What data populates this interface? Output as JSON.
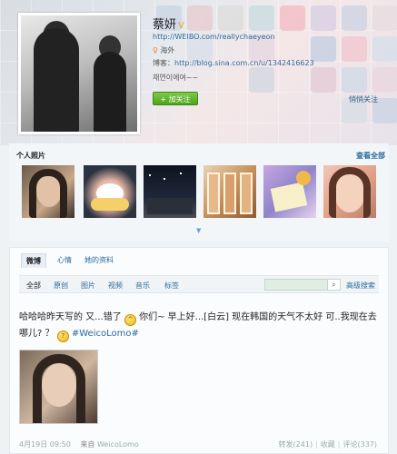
{
  "profile": {
    "name": "蔡妍",
    "verified_badge": "V",
    "url": "http://WEIBO.com/reallychaeyeon",
    "location": "海外",
    "blog_label": "博客：",
    "blog_url": "http://blog.sina.com.cn/u/1342416623",
    "bio": "채연이에여~~",
    "follow_button": "+ 加关注",
    "mutual_follow": "悄悄关注"
  },
  "photos": {
    "title": "个人照片",
    "see_all": "查看全部"
  },
  "tabs": [
    "微博",
    "心情",
    "她的资料"
  ],
  "filters": [
    "全部",
    "原创",
    "图片",
    "视频",
    "音乐",
    "标签"
  ],
  "search": {
    "placeholder": "",
    "advanced": "高级搜索"
  },
  "post": {
    "text_1": "哈哈哈昨天写的 又...错了",
    "text_2": "你们~ 早上好...[白云] 现在韩国的天气不太好 可..我现在去",
    "text_3": "哪儿? ？",
    "hashtag": "#WeicoLomo#",
    "date": "4月19日 09:50",
    "from_label": "来自",
    "client": "WeicoLomo",
    "repost": "转发(241)",
    "favorite": "收藏",
    "comment": "评论(337)"
  }
}
